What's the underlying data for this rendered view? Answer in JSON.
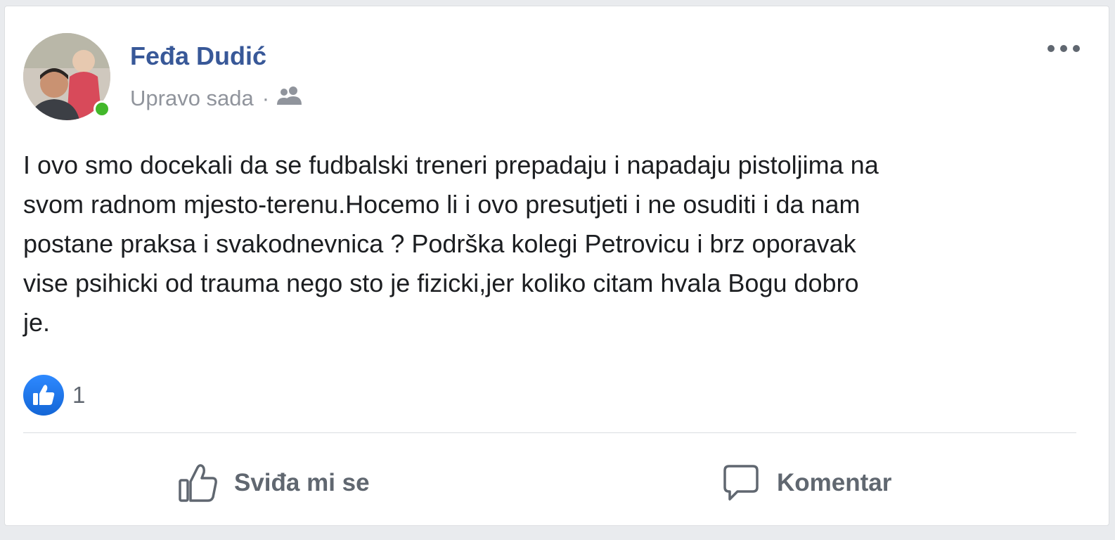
{
  "post": {
    "author": "Feđa Dudić",
    "time": "Upravo sada",
    "separator": "·",
    "privacy_icon": "friends-icon",
    "text": "I ovo smo docekali da se fudbalski treneri prepadaju i napadaju pistoljima na\nsvom radnom mjesto-terenu.Hocemo li i ovo presutjeti i ne osuditi i da nam\npostane praksa i svakodnevnica ? Podrška kolegi Petrovicu i brz oporavak\nvise psihicki od trauma nego sto je fizicki,jer koliko citam hvala Bogu dobro\nje.",
    "reactions": {
      "icon": "like-reaction-icon",
      "count": "1"
    }
  },
  "actions": {
    "like_label": "Sviđa mi se",
    "comment_label": "Komentar"
  },
  "colors": {
    "author": "#385898",
    "meta": "#90949c",
    "text": "#1c1e21",
    "like_blue": "#1877f2",
    "online": "#42b72a",
    "action": "#606770"
  }
}
